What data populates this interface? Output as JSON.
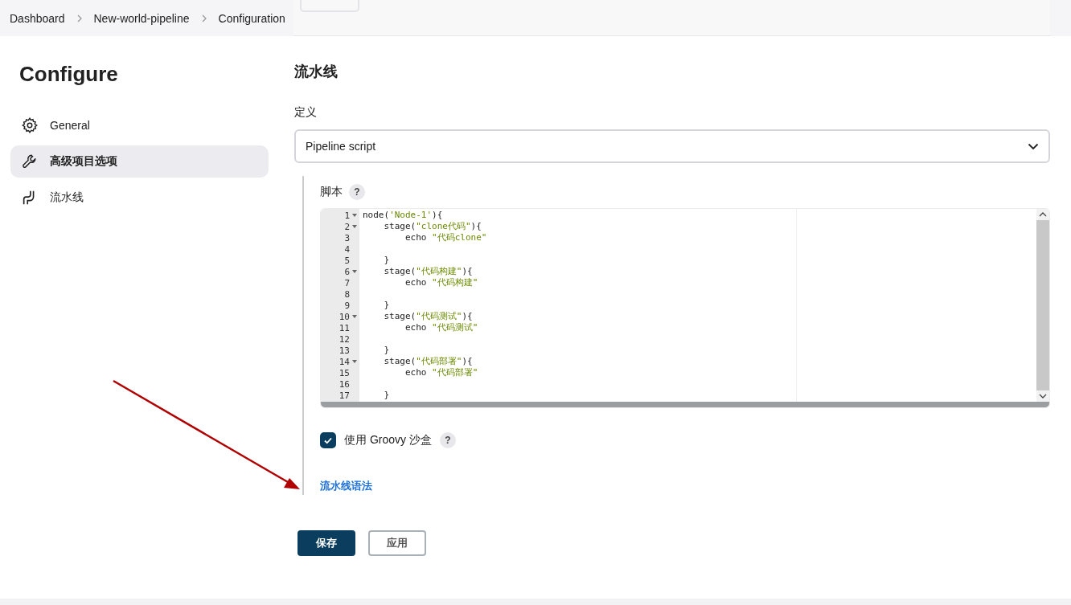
{
  "breadcrumbs": [
    {
      "label": "Dashboard"
    },
    {
      "label": "New-world-pipeline"
    },
    {
      "label": "Configuration"
    }
  ],
  "sidebar": {
    "title": "Configure",
    "items": [
      {
        "label": "General",
        "selected": false
      },
      {
        "label": "高级项目选项",
        "selected": true
      },
      {
        "label": "流水线",
        "selected": false
      }
    ]
  },
  "section": {
    "title": "流水线",
    "definition_label": "定义",
    "definition_value": "Pipeline script",
    "script_label": "脚本",
    "script_help": "?",
    "code": [
      {
        "number": "1",
        "fold": true,
        "parts": [
          {
            "kind": "plain",
            "text": "node("
          },
          {
            "kind": "string",
            "text": "'Node-1'"
          },
          {
            "kind": "plain",
            "text": "){"
          }
        ]
      },
      {
        "number": "2",
        "fold": true,
        "parts": [
          {
            "kind": "plain",
            "text": "    stage("
          },
          {
            "kind": "string",
            "text": "\"clone代码\""
          },
          {
            "kind": "plain",
            "text": "){"
          }
        ]
      },
      {
        "number": "3",
        "fold": false,
        "parts": [
          {
            "kind": "plain",
            "text": "        echo "
          },
          {
            "kind": "string",
            "text": "\"代码clone\""
          }
        ]
      },
      {
        "number": "4",
        "fold": false
      },
      {
        "number": "5",
        "fold": false,
        "parts": [
          {
            "kind": "plain",
            "text": "    }"
          }
        ]
      },
      {
        "number": "6",
        "fold": true,
        "parts": [
          {
            "kind": "plain",
            "text": "    stage("
          },
          {
            "kind": "string",
            "text": "\"代码构建\""
          },
          {
            "kind": "plain",
            "text": "){"
          }
        ]
      },
      {
        "number": "7",
        "fold": false,
        "parts": [
          {
            "kind": "plain",
            "text": "        echo "
          },
          {
            "kind": "string",
            "text": "\"代码构建\""
          }
        ]
      },
      {
        "number": "8",
        "fold": false
      },
      {
        "number": "9",
        "fold": false,
        "parts": [
          {
            "kind": "plain",
            "text": "    }"
          }
        ]
      },
      {
        "number": "10",
        "fold": true,
        "parts": [
          {
            "kind": "plain",
            "text": "    stage("
          },
          {
            "kind": "string",
            "text": "\"代码测试\""
          },
          {
            "kind": "plain",
            "text": "){"
          }
        ]
      },
      {
        "number": "11",
        "fold": false,
        "parts": [
          {
            "kind": "plain",
            "text": "        echo "
          },
          {
            "kind": "string",
            "text": "\"代码测试\""
          }
        ]
      },
      {
        "number": "12",
        "fold": false
      },
      {
        "number": "13",
        "fold": false,
        "parts": [
          {
            "kind": "plain",
            "text": "    }"
          }
        ]
      },
      {
        "number": "14",
        "fold": true,
        "parts": [
          {
            "kind": "plain",
            "text": "    stage("
          },
          {
            "kind": "string",
            "text": "\"代码部署\""
          },
          {
            "kind": "plain",
            "text": "){"
          }
        ]
      },
      {
        "number": "15",
        "fold": false,
        "parts": [
          {
            "kind": "plain",
            "text": "        echo "
          },
          {
            "kind": "string",
            "text": "\"代码部署\""
          }
        ]
      },
      {
        "number": "16",
        "fold": false
      },
      {
        "number": "17",
        "fold": false,
        "parts": [
          {
            "kind": "plain",
            "text": "    }"
          }
        ]
      }
    ],
    "sandbox": {
      "label": "使用 Groovy 沙盒",
      "checked": true,
      "help": "?"
    },
    "syntax_link": "流水线语法"
  },
  "buttons": [
    {
      "label": "保存",
      "kind": "primary"
    },
    {
      "label": "应用",
      "kind": "secondary"
    }
  ]
}
